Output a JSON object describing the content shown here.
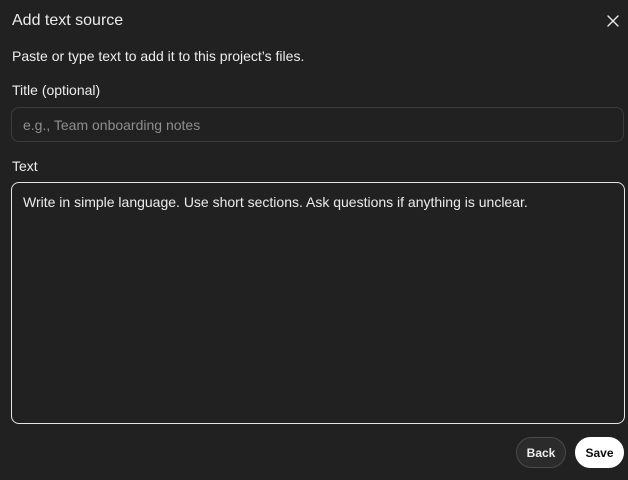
{
  "dialog": {
    "title": "Add text source",
    "subtitle": "Paste or type text to add it to this project’s files.",
    "close_icon": "close-icon"
  },
  "title_field": {
    "label": "Title (optional)",
    "value": "",
    "placeholder": "e.g., Team onboarding notes"
  },
  "text_field": {
    "label": "Text",
    "value": "Write in simple language. Use short sections. Ask questions if anything is unclear."
  },
  "actions": {
    "back_label": "Back",
    "save_label": "Save"
  },
  "colors": {
    "background": "#212121",
    "text": "#ececec",
    "placeholder": "#8e8e8e",
    "input_border": "#3c3c3c",
    "focused_border": "#e6e6e6",
    "primary_button": "#ffffff"
  }
}
